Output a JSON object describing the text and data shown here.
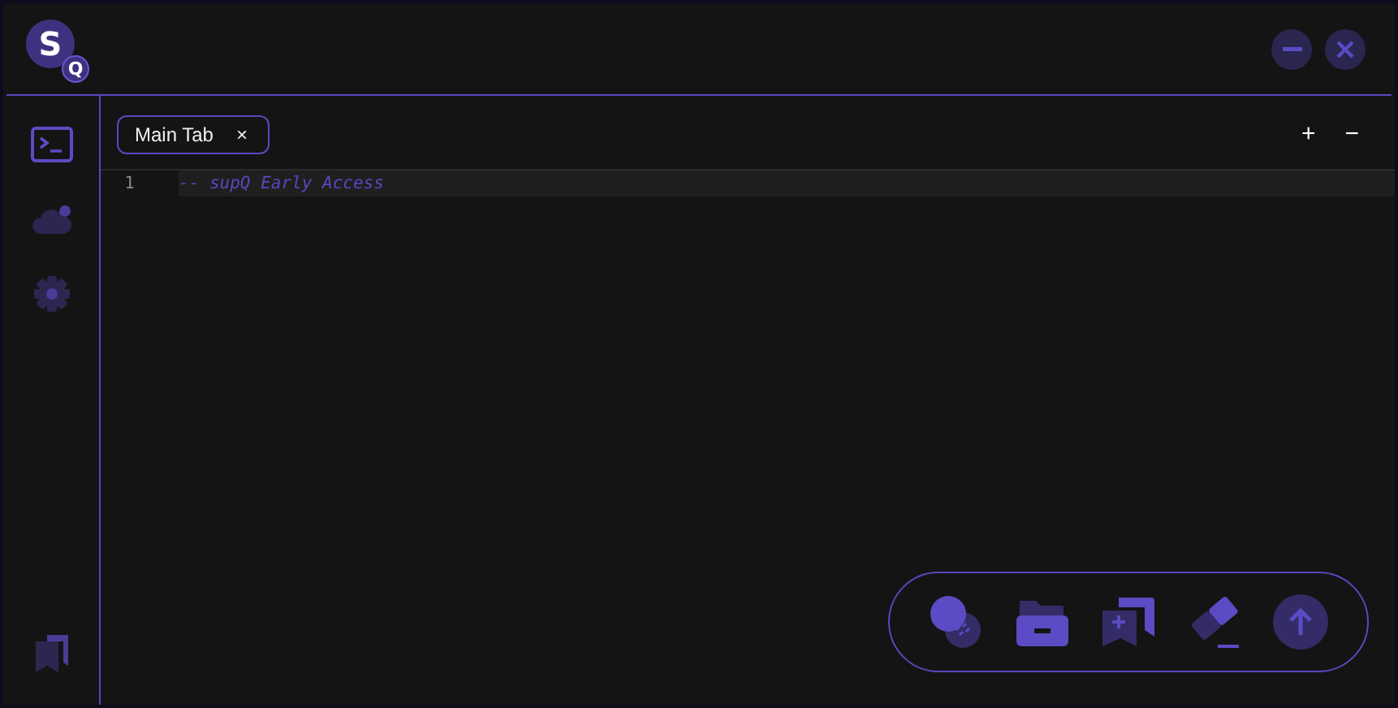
{
  "logo": {
    "main": "S",
    "sub": "Q"
  },
  "sidebar": {
    "items": [
      {
        "kind": "terminal",
        "selected": true
      },
      {
        "kind": "cloud",
        "selected": false
      },
      {
        "kind": "gear",
        "selected": false
      }
    ],
    "bottom": {
      "kind": "bookmarks"
    }
  },
  "tabs": [
    {
      "label": "Main Tab",
      "close": "×",
      "selected": true
    }
  ],
  "tab_actions": [
    "+",
    "−"
  ],
  "editor": {
    "lines": [
      {
        "number": "1",
        "text": "-- supQ Early Access"
      }
    ]
  },
  "toolbar": [
    {
      "kind": "blob"
    },
    {
      "kind": "folder"
    },
    {
      "kind": "bookmark-add"
    },
    {
      "kind": "eraser"
    },
    {
      "kind": "upload"
    }
  ]
}
